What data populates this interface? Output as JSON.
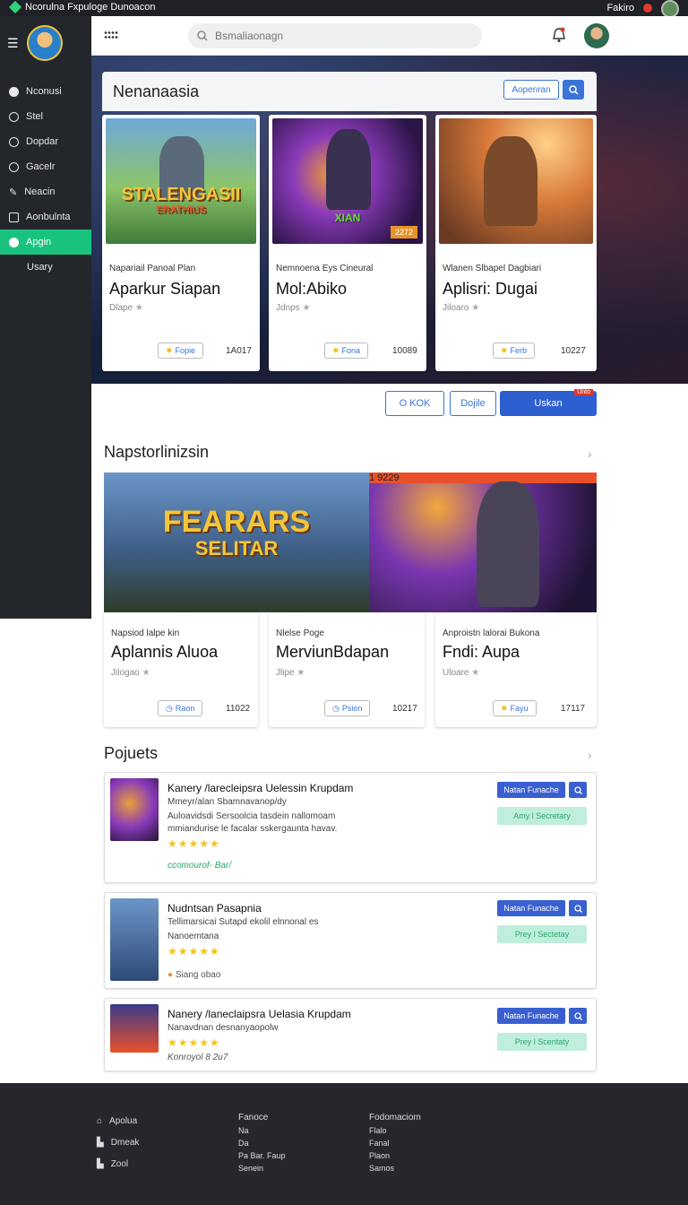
{
  "topbar": {
    "title": "Ncorulna Fxpuloge Dunoacon",
    "right_label": "Fakiro"
  },
  "sidebar": {
    "items": [
      {
        "label": "Nconusi",
        "icon": "dot-icon"
      },
      {
        "label": "Stel",
        "icon": "refresh-icon"
      },
      {
        "label": "Dopdar",
        "icon": "refresh-icon"
      },
      {
        "label": "Gacelr",
        "icon": "target-icon"
      },
      {
        "label": "Neacin",
        "icon": "pin-icon"
      },
      {
        "label": "Aonbulnta",
        "icon": "bag-icon"
      },
      {
        "label": "Apgin",
        "icon": "dot-icon",
        "active": true
      },
      {
        "label": "Usary",
        "icon": ""
      }
    ]
  },
  "header": {
    "search_placeholder": "Bsmaliaonagn"
  },
  "hero": {
    "panel_title": "Nenanaasia",
    "panel_button": "Aopenran",
    "cards": [
      {
        "art_title": "STALENGASII",
        "art_sub": "ERATHIUS",
        "sub": "Napariail Panoal Plan",
        "name": "Aparkur Siapan",
        "meta": "Dlape",
        "btn": "Fopie",
        "num": "1A017"
      },
      {
        "art_title": "",
        "art_badge": "XIAN",
        "art_label": "2272",
        "sub": "Nemnoena Eys Cineural",
        "name": "Mol:Abiko",
        "meta": "Jdnps",
        "btn": "Fona",
        "num": "10089"
      },
      {
        "art_title": "",
        "sub": "Wlanen Slbapel Dagbiari",
        "name": "Aplisri: Dugai",
        "meta": "Jiloaro",
        "btn": "Ferb",
        "num": "10227"
      }
    ]
  },
  "actions": {
    "btn1": "O KOK",
    "btn2": "Dojile",
    "btn3": "Uskan",
    "btn3_badge": "Unto"
  },
  "section1": {
    "title": "Napstorlinizsin",
    "promo_title": "FEARARS",
    "promo_sub": "SELITAR",
    "promo_label": "1 9229",
    "cards": [
      {
        "sub": "Napsiod lalpe kin",
        "name": "Aplannis Aluoa",
        "meta": "Jilogao",
        "btn": "Raon",
        "num": "11022"
      },
      {
        "sub": "Nlelse Poge",
        "name": "MerviunBdapan",
        "meta": "Jlipe",
        "btn": "Psion",
        "num": "10217"
      },
      {
        "sub": "Anproistn lalorai Bukona",
        "name": "Fndi: Aupa",
        "meta": "Uloare",
        "btn": "Fayu",
        "num": "17117"
      }
    ]
  },
  "section2": {
    "title": "Pojuets",
    "items": [
      {
        "title": "Kanery /larecleipsra Uelessin Krupdam",
        "desc": [
          "Mmeyr/alan Sbamnavanop/dy",
          "Auloavidsdi Sersoolcia tasdein nallomoam",
          "mmiandurise le facalar sskergaunta havav."
        ],
        "stars": "★★★★★",
        "foot": "ccomourof- Bar/",
        "b1": "Natan Funache",
        "b3": "Amy l Secretary"
      },
      {
        "title": "Nudntsan Pasapnia",
        "desc": [
          "Tellimarsicai Sutapd ekolil elnnonal es",
          "Nanoemtana"
        ],
        "stars": "★★★★★",
        "foot": "Siang obao",
        "b1": "Natan Funache",
        "b3": "Prey l Sectetay"
      },
      {
        "title": "Nanery /laneclaipsra Uelasia Krupdam",
        "desc": [
          "Nanavdnan desnanyaopolw"
        ],
        "stars": "★★★★★",
        "foot": "Konroyol 8 2u7",
        "b1": "Natan Funache",
        "b3": "Prey l Scentaty"
      }
    ]
  },
  "footer": {
    "col1": [
      "Apolua",
      "Dmeak",
      "Zool"
    ],
    "col2_head": "Fanoce",
    "col2": [
      "Na",
      "Da",
      "Pa Bar. Faup",
      "Senein"
    ],
    "col3_head": "Fodomaciom",
    "col3": [
      "Flalo",
      "Fanal",
      "Plaon",
      "Samos"
    ]
  },
  "colors": {
    "accent": "#19c37d",
    "primary": "#3a74d8",
    "dark": "#23262b"
  }
}
